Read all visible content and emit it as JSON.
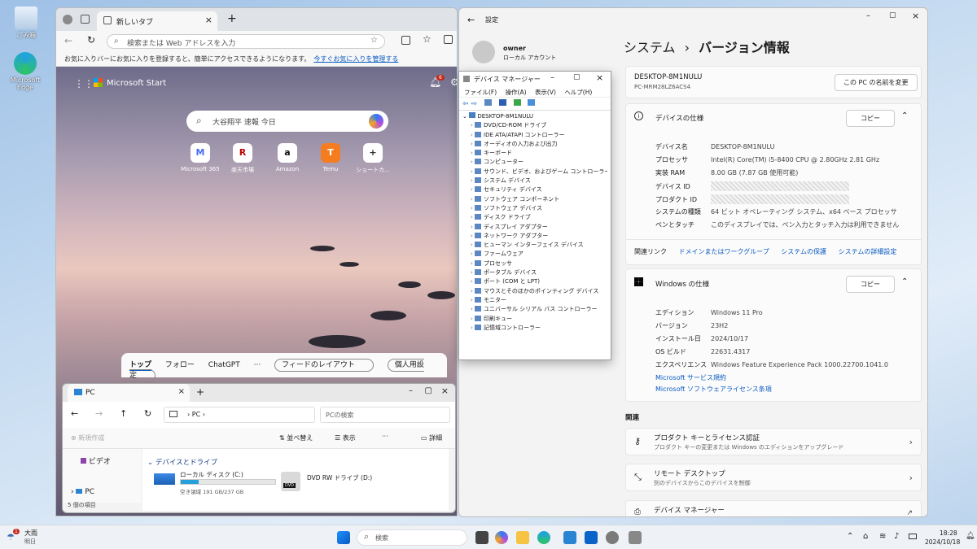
{
  "desktop": {
    "icons": [
      {
        "label": "ごみ箱"
      },
      {
        "label": "Microsoft Edge"
      }
    ]
  },
  "edge": {
    "tab_title": "新しいタブ",
    "address_placeholder": "検索または Web アドレスを入力",
    "favorites_text": "お気に入りバーにお気に入りを登録すると、簡単にアクセスできるようになります。",
    "favorites_link": "今すぐお気に入りを管理する",
    "brand": "Microsoft Start",
    "notification_count": "6",
    "search_query": "大谷翔平 速報 今日",
    "shortcuts": [
      {
        "label": "Microsoft 365",
        "icon": "M"
      },
      {
        "label": "楽天市場",
        "icon": "R"
      },
      {
        "label": "Amazon",
        "icon": "a"
      },
      {
        "label": "Temu",
        "icon": "T"
      },
      {
        "label": "ショートカ...",
        "icon": "+"
      }
    ],
    "feed_tabs": [
      "トップ",
      "フォロー",
      "ChatGPT",
      "···"
    ],
    "feed_layout": "フィードのレイアウト",
    "personalize": "個人用設定"
  },
  "explorer": {
    "title": "PC",
    "path": "PC",
    "search_placeholder": "PCの検索",
    "new_label": "新規作成",
    "sort_label": "並べ替え",
    "view_label": "表示",
    "more_label": "···",
    "details_label": "詳細",
    "nav_video": "ビデオ",
    "nav_pc": "PC",
    "status": "5 個の項目",
    "section": "デバイスとドライブ",
    "drive_c": {
      "name": "ローカル ディスク (C:)",
      "free": "空き領域 191 GB/237 GB",
      "used_fraction": 0.19
    },
    "drive_d": {
      "name": "DVD RW ドライブ (D:)",
      "badge": "DVD"
    }
  },
  "devmgr": {
    "title": "デバイス マネージャー",
    "menu": [
      "ファイル(F)",
      "操作(A)",
      "表示(V)",
      "ヘルプ(H)"
    ],
    "root": "DESKTOP-8M1NULU",
    "items": [
      "DVD/CD-ROM ドライブ",
      "IDE ATA/ATAPI コントローラー",
      "オーディオの入力および出力",
      "キーボード",
      "コンピューター",
      "サウンド、ビデオ、およびゲーム コントローラー",
      "システム デバイス",
      "セキュリティ デバイス",
      "ソフトウェア コンポーネント",
      "ソフトウェア デバイス",
      "ディスク ドライブ",
      "ディスプレイ アダプター",
      "ネットワーク アダプター",
      "ヒューマン インターフェイス デバイス",
      "ファームウェア",
      "プロセッサ",
      "ポータブル デバイス",
      "ポート (COM と LPT)",
      "マウスとそのほかのポインティング デバイス",
      "モニター",
      "ユニバーサル シリアル バス コントローラー",
      "印刷キュー",
      "記憶域コントローラー"
    ]
  },
  "settings": {
    "app_title": "設定",
    "user_name": "owner",
    "user_type": "ローカル アカウント",
    "breadcrumb_parent": "システム",
    "breadcrumb_sep": "›",
    "page_title": "バージョン情報",
    "device_name": "DESKTOP-8M1NULU",
    "device_model": "PC-MRM28LZ6ACS4",
    "rename_button": "この PC の名前を変更",
    "device_spec_title": "デバイスの仕様",
    "copy": "コピー",
    "device_specs": [
      {
        "k": "デバイス名",
        "v": "DESKTOP-8M1NULU"
      },
      {
        "k": "プロセッサ",
        "v": "Intel(R) Core(TM) i5-8400 CPU @ 2.80GHz   2.81 GHz"
      },
      {
        "k": "実装 RAM",
        "v": "8.00 GB (7.87 GB 使用可能)"
      },
      {
        "k": "デバイス ID",
        "v": ""
      },
      {
        "k": "プロダクト ID",
        "v": ""
      },
      {
        "k": "システムの種類",
        "v": "64 ビット オペレーティング システム、x64 ベース プロセッサ"
      },
      {
        "k": "ペンとタッチ",
        "v": "このディスプレイでは、ペン入力とタッチ入力は利用できません"
      }
    ],
    "related_links_label": "関連リンク",
    "related_links": [
      "ドメインまたはワークグループ",
      "システムの保護",
      "システムの詳細設定"
    ],
    "windows_spec_title": "Windows の仕様",
    "windows_specs": [
      {
        "k": "エディション",
        "v": "Windows 11 Pro"
      },
      {
        "k": "バージョン",
        "v": "23H2"
      },
      {
        "k": "インストール日",
        "v": "2024/10/17"
      },
      {
        "k": "OS ビルド",
        "v": "22631.4317"
      },
      {
        "k": "エクスペリエンス",
        "v": "Windows Feature Experience Pack 1000.22700.1041.0"
      }
    ],
    "ms_links": [
      "Microsoft サービス規約",
      "Microsoft ソフトウェアライセンス条項"
    ],
    "related_title": "関連",
    "related_items": [
      {
        "t": "プロダクト キーとライセンス認証",
        "s": "プロダクト キーの変更または Windows のエディションをアップグレード"
      },
      {
        "t": "リモート デスクトップ",
        "s": "別のデバイスからこのデバイスを制御"
      },
      {
        "t": "デバイス マネージャー",
        "s": ""
      }
    ]
  },
  "taskbar": {
    "weather_temp": "大雨",
    "weather_day": "明日",
    "weather_alert": "1",
    "search_placeholder": "検索",
    "time": "18:28",
    "date": "2024/10/18"
  }
}
